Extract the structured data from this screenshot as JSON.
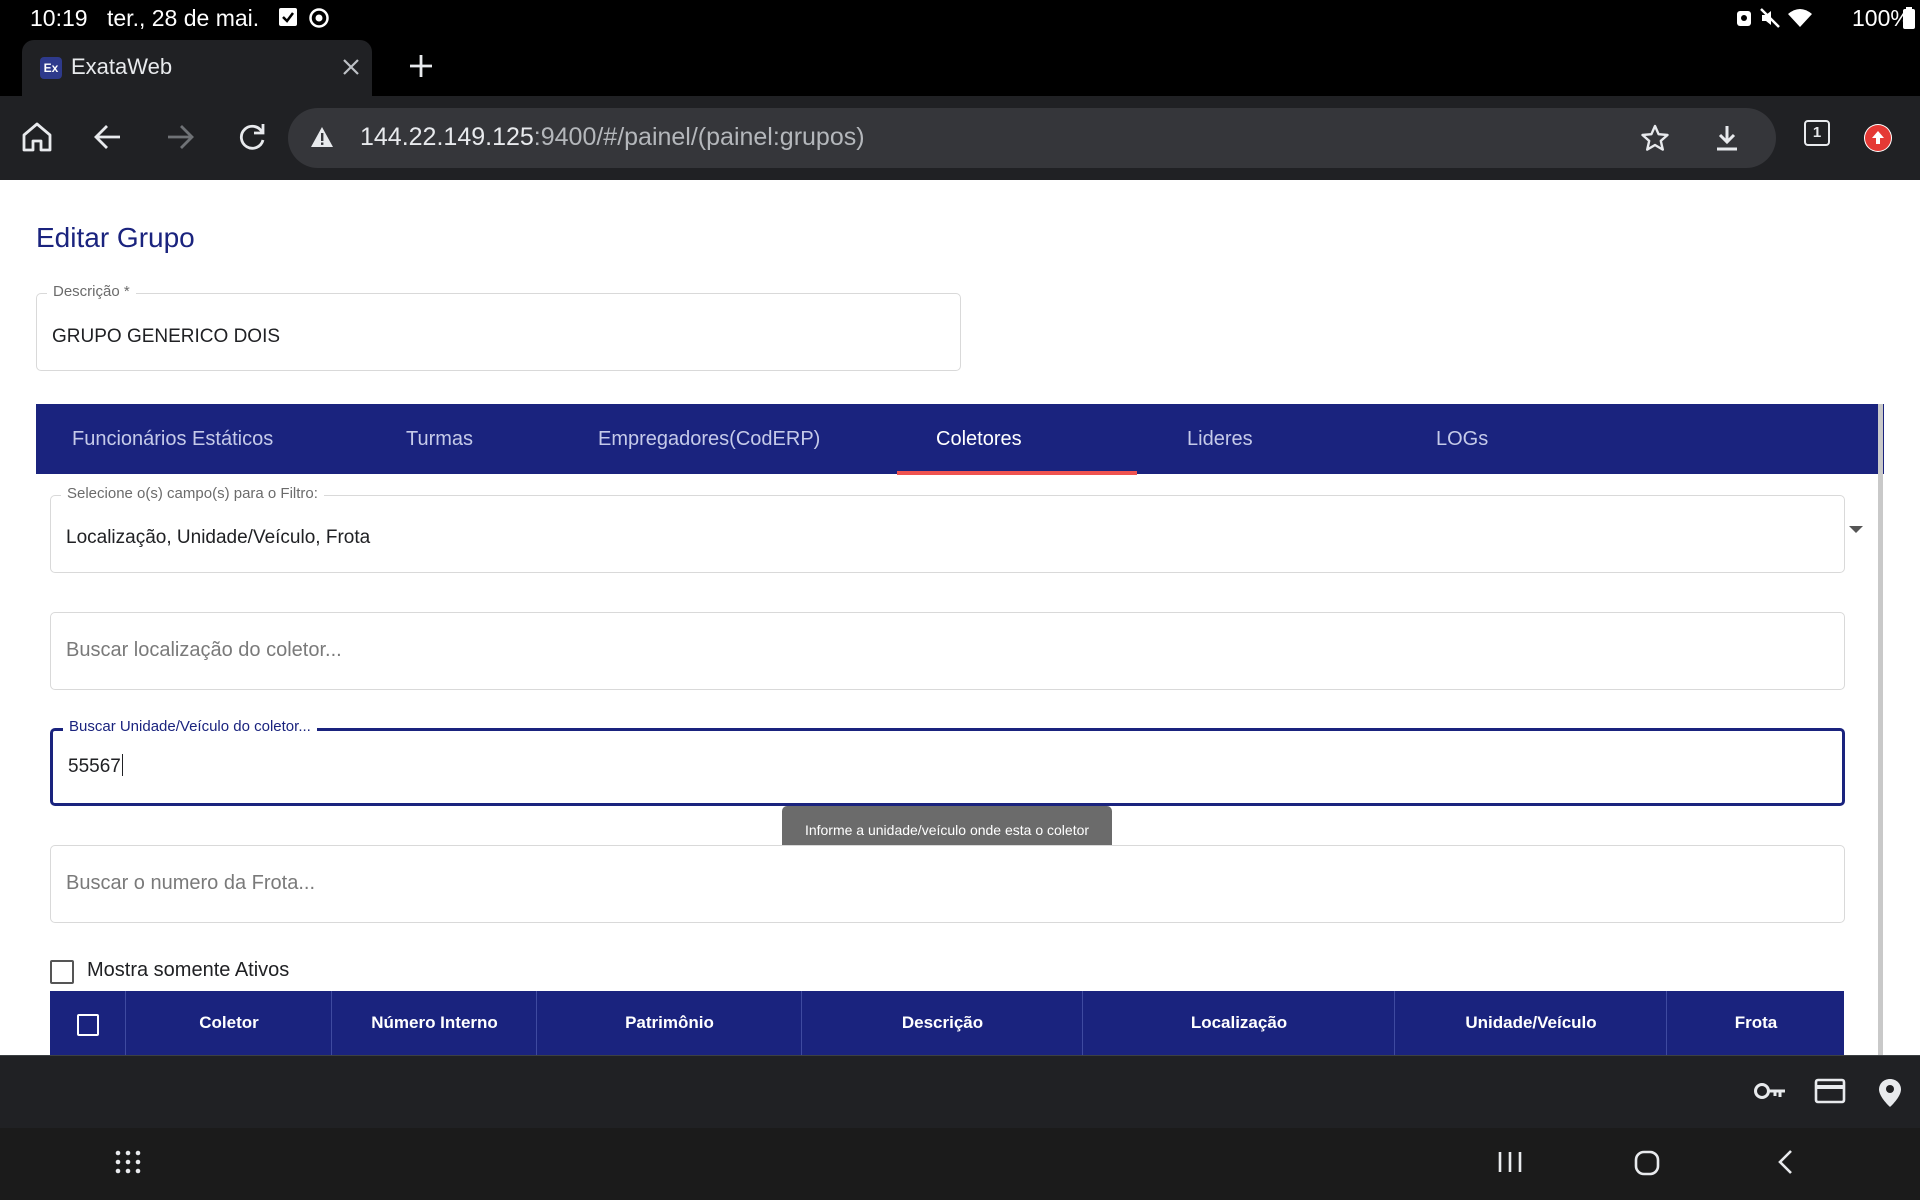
{
  "status_bar": {
    "time": "10:19",
    "date": "ter., 28 de mai.",
    "battery": "100%"
  },
  "browser": {
    "tab": {
      "favicon_text": "Ex",
      "title": "ExataWeb"
    },
    "url": {
      "host": "144.22.149.125",
      "rest": ":9400/#/painel/(painel:grupos)"
    },
    "tab_count": "1"
  },
  "page": {
    "title": "Editar Grupo",
    "descricao": {
      "label": "Descrição *",
      "value": "GRUPO GENERICO DOIS"
    },
    "tabs": [
      {
        "label": "Funcionários Estáticos"
      },
      {
        "label": "Turmas"
      },
      {
        "label": "Empregadores(CodERP)"
      },
      {
        "label": "Coletores"
      },
      {
        "label": "Lideres"
      },
      {
        "label": "LOGs"
      }
    ],
    "active_tab": "Coletores",
    "filter_select": {
      "label": "Selecione o(s) campo(s) para o Filtro:",
      "value": "Localização, Unidade/Veículo, Frota"
    },
    "search_localizacao": {
      "placeholder": "Buscar localização do coletor..."
    },
    "search_unidade": {
      "label": "Buscar Unidade/Veículo do coletor...",
      "value": "55567"
    },
    "tooltip": "Informe a unidade/veículo onde esta o coletor",
    "search_frota": {
      "placeholder": "Buscar o numero da Frota..."
    },
    "only_active": {
      "label": "Mostra somente Ativos",
      "checked": false
    },
    "table": {
      "columns": [
        "Coletor",
        "Número Interno",
        "Patrimônio",
        "Descrição",
        "Localização",
        "Unidade/Veículo",
        "Frota"
      ]
    }
  },
  "colors": {
    "primary": "#1a237e",
    "tab_indicator": "#ef5350",
    "browser_chrome": "#202124"
  }
}
